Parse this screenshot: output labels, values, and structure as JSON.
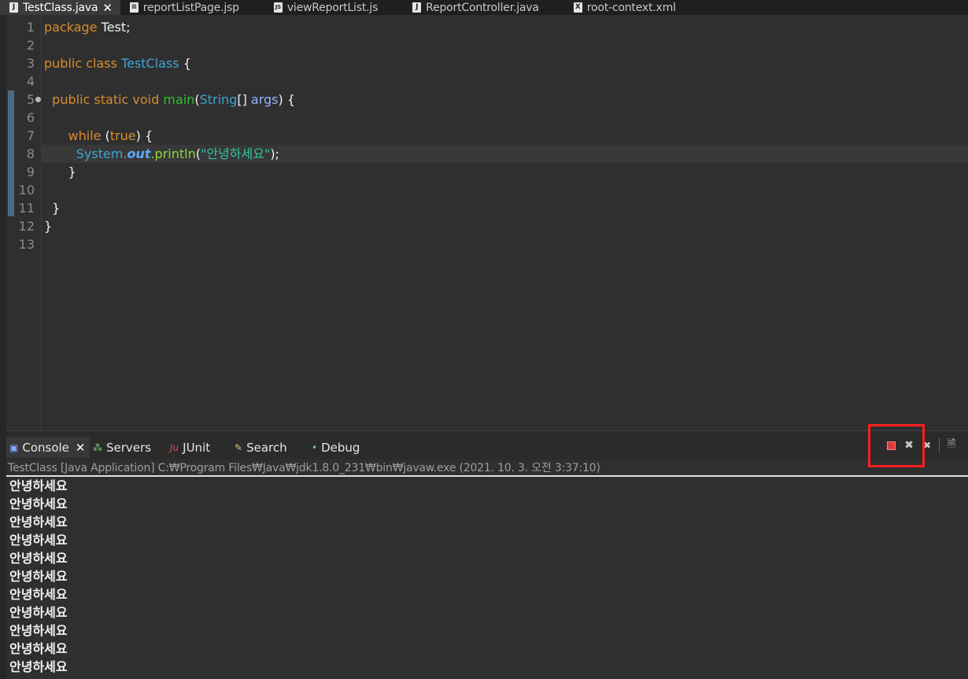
{
  "editor_tabs": [
    {
      "label": "TestClass.java",
      "icon": "J",
      "active": true
    },
    {
      "label": "reportListPage.jsp",
      "icon": "≡",
      "active": false
    },
    {
      "label": "viewReportList.js",
      "icon": "JS",
      "active": false
    },
    {
      "label": "ReportController.java",
      "icon": "J",
      "active": false
    },
    {
      "label": "root-context.xml",
      "icon": "X",
      "active": false
    }
  ],
  "editor": {
    "line_numbers": [
      "1",
      "2",
      "3",
      "4",
      "5",
      "6",
      "7",
      "8",
      "9",
      "10",
      "11",
      "12",
      "13"
    ],
    "code": {
      "l1_kw": "package",
      "l1_rest": " Test;",
      "l3_kw": "public class",
      "l3_cls": " TestClass",
      "l3_rest": " {",
      "l5_kw": "  public static void",
      "l5_meth": " main",
      "l5_p1": "(",
      "l5_type": "String",
      "l5_p2": "[] ",
      "l5_arg": "args",
      "l5_rest": ") {",
      "l7_kw": "      while",
      "l7_p1": " (",
      "l7_true": "true",
      "l7_rest": ") {",
      "l8_sys": "        System.",
      "l8_out": "out",
      "l8_call": ".println",
      "l8_p1": "(",
      "l8_str": "\"안녕하세요\"",
      "l8_rest": ");",
      "l9": "      }",
      "l11": "  }",
      "l12": "}"
    }
  },
  "panel_tabs": [
    {
      "label": "Console",
      "icon": "▣",
      "active": true
    },
    {
      "label": "Servers",
      "icon": "⁂",
      "active": false
    },
    {
      "label": "JUnit",
      "icon": "Ju",
      "active": false
    },
    {
      "label": "Search",
      "icon": "✎",
      "active": false
    },
    {
      "label": "Debug",
      "icon": "•",
      "active": false
    }
  ],
  "console": {
    "header": "TestClass [Java Application] C:₩Program Files₩Java₩jdk1.8.0_231₩bin₩javaw.exe (2021. 10. 3. 오전 3:37:10)",
    "output_lines": [
      "안녕하세요",
      "안녕하세요",
      "안녕하세요",
      "안녕하세요",
      "안녕하세요",
      "안녕하세요",
      "안녕하세요",
      "안녕하세요",
      "안녕하세요",
      "안녕하세요",
      "안녕하세요"
    ]
  },
  "toolbar": {
    "icons": [
      "terminate-icon",
      "remove-launch-icon",
      "remove-all-terminated-icon",
      "clear-console-icon"
    ],
    "remove_glyph": "✖",
    "remove_all_glyph": "✖",
    "clear_glyph": "🗎"
  },
  "colors": {
    "highlight_box": "#ff1f1f",
    "keyword": "#d98c2c",
    "class_name": "#3ea3d4",
    "string": "#2fc7a0"
  }
}
